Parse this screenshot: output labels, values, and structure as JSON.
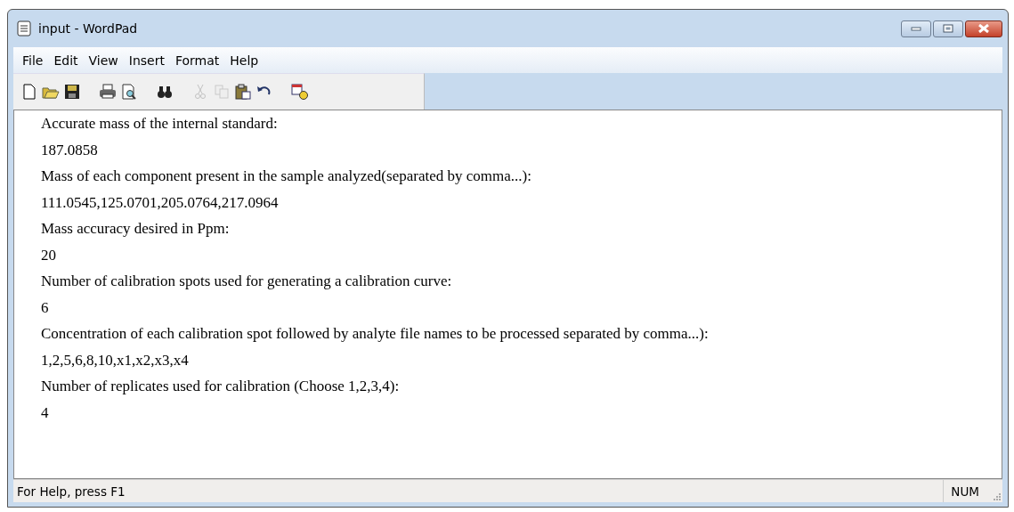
{
  "window": {
    "title": "input - WordPad"
  },
  "menu": [
    "File",
    "Edit",
    "View",
    "Insert",
    "Format",
    "Help"
  ],
  "toolbar": [
    {
      "kind": "new",
      "disabled": false
    },
    {
      "kind": "open",
      "disabled": false
    },
    {
      "kind": "save",
      "disabled": false
    },
    {
      "kind": "gap"
    },
    {
      "kind": "print",
      "disabled": false
    },
    {
      "kind": "preview",
      "disabled": false
    },
    {
      "kind": "gap"
    },
    {
      "kind": "find",
      "disabled": false
    },
    {
      "kind": "gap"
    },
    {
      "kind": "cut",
      "disabled": true
    },
    {
      "kind": "copy",
      "disabled": true
    },
    {
      "kind": "paste",
      "disabled": false
    },
    {
      "kind": "undo",
      "disabled": false
    },
    {
      "kind": "gap"
    },
    {
      "kind": "datetime",
      "disabled": false
    }
  ],
  "document": {
    "lines": [
      "Accurate mass of the internal standard:",
      "187.0858",
      "Mass of each component present in the sample analyzed(separated by comma...):",
      "111.0545,125.0701,205.0764,217.0964",
      "Mass accuracy desired in Ppm:",
      "20",
      "Number of calibration spots used for generating a calibration curve:",
      "6",
      "Concentration of each calibration spot followed by analyte file names to be processed separated by comma...):",
      "1,2,5,6,8,10,x1,x2,x3,x4",
      "Number of replicates used for calibration (Choose 1,2,3,4):",
      "4"
    ]
  },
  "status_bar": {
    "help": "For Help, press F1",
    "num": "NUM"
  }
}
